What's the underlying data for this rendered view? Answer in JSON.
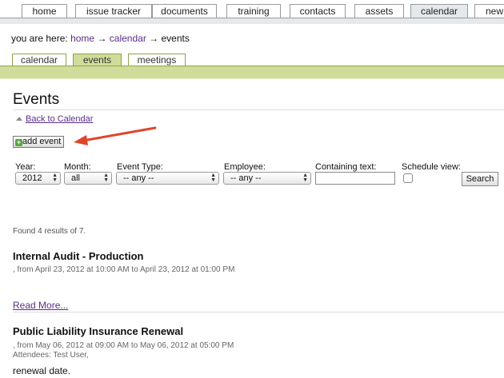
{
  "nav": {
    "tabs": [
      {
        "label": "home"
      },
      {
        "label": "issue tracker"
      },
      {
        "label": "documents"
      },
      {
        "label": "training"
      },
      {
        "label": "contacts"
      },
      {
        "label": "assets"
      },
      {
        "label": "calendar"
      },
      {
        "label": "new"
      }
    ],
    "active": "calendar"
  },
  "breadcrumb": {
    "prefix": "you are here:",
    "home": "home",
    "calendar": "calendar",
    "current": "events",
    "separator": "→"
  },
  "subtabs": [
    {
      "label": "calendar"
    },
    {
      "label": "events"
    },
    {
      "label": "meetings"
    }
  ],
  "page": {
    "title": "Events",
    "back_link": "Back to Calendar",
    "add_event": "add event"
  },
  "filters": {
    "year_label": "Year:",
    "year_value": "2012",
    "month_label": "Month:",
    "month_value": "all",
    "event_type_label": "Event Type:",
    "event_type_value": "-- any --",
    "employee_label": "Employee:",
    "employee_value": "-- any --",
    "text_label": "Containing text:",
    "text_value": "",
    "schedule_label": "Schedule view:",
    "search_button": "Search"
  },
  "results": "Found 4 results of 7.",
  "events": [
    {
      "title": "Internal Audit - Production",
      "date": ", from April 23, 2012 at 10:00 AM to April 23, 2012 at 01:00 PM",
      "read_more": "Read More..."
    },
    {
      "title": "Public Liability Insurance Renewal",
      "date": ", from May 06, 2012 at 09:00 AM to May 06, 2012 at 05:00 PM",
      "attendees": "Attendees:  Test User,",
      "description": "renewal date."
    }
  ],
  "colors": {
    "accent_green": "#cfdc9a",
    "link_purple": "#5b2e8a",
    "annotation_arrow": "#e0452a"
  }
}
